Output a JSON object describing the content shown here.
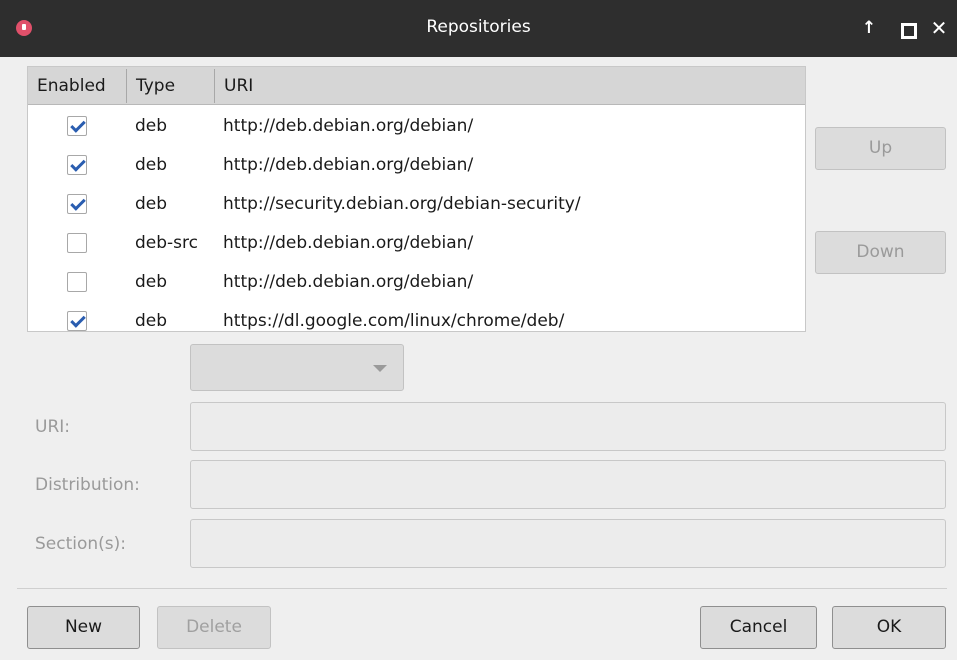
{
  "window": {
    "title": "Repositories",
    "controls": {
      "up": "↑",
      "close": "✕"
    }
  },
  "table": {
    "headers": {
      "enabled": "Enabled",
      "type": "Type",
      "uri": "URI"
    },
    "rows": [
      {
        "enabled": true,
        "type": "deb",
        "uri": "http://deb.debian.org/debian/"
      },
      {
        "enabled": true,
        "type": "deb",
        "uri": "http://deb.debian.org/debian/"
      },
      {
        "enabled": true,
        "type": "deb",
        "uri": "http://security.debian.org/debian-security/"
      },
      {
        "enabled": false,
        "type": "deb-src",
        "uri": "http://deb.debian.org/debian/"
      },
      {
        "enabled": false,
        "type": "deb",
        "uri": "http://deb.debian.org/debian/"
      },
      {
        "enabled": true,
        "type": "deb",
        "uri": "https://dl.google.com/linux/chrome/deb/"
      }
    ]
  },
  "side_buttons": {
    "up": "Up",
    "down": "Down"
  },
  "form": {
    "type_combo_value": "",
    "uri_label": "URI:",
    "uri_value": "",
    "distribution_label": "Distribution:",
    "distribution_value": "",
    "sections_label": "Section(s):",
    "sections_value": ""
  },
  "footer": {
    "new": "New",
    "delete": "Delete",
    "cancel": "Cancel",
    "ok": "OK"
  },
  "colors": {
    "titlebar": "#2e2e2e",
    "check": "#2a5db0",
    "app_icon": "#e0506a"
  }
}
